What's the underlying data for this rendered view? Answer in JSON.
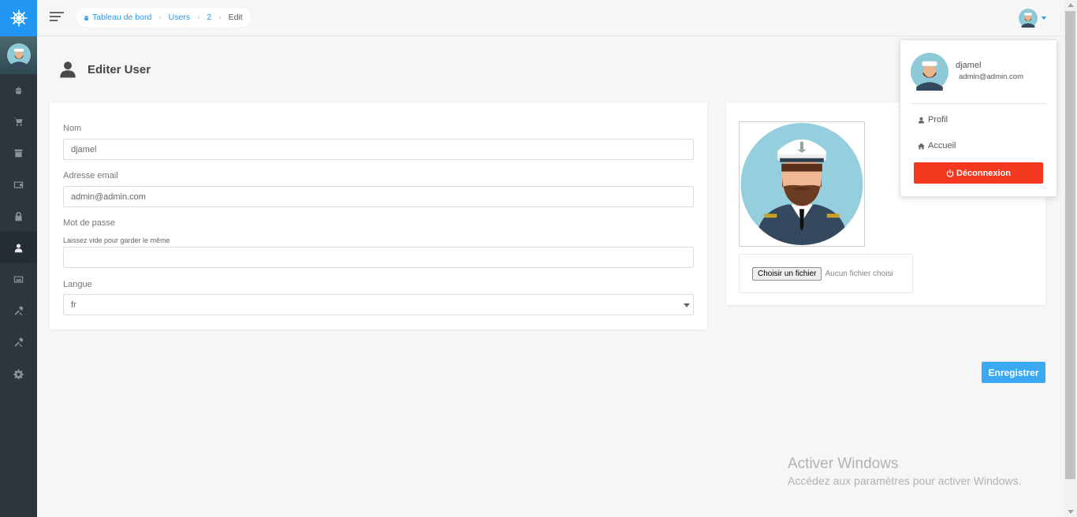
{
  "breadcrumb": {
    "items": [
      {
        "label": "Tableau de bord"
      },
      {
        "label": "Users"
      },
      {
        "label": "2"
      },
      {
        "label": "Edit"
      }
    ]
  },
  "page": {
    "title": "Editer User"
  },
  "form": {
    "name_label": "Nom",
    "name_value": "djamel",
    "email_label": "Adresse email",
    "email_value": "admin@admin.com",
    "password_label": "Mot de passe",
    "password_hint": "Laissez vide pour garder le même",
    "password_value": "",
    "language_label": "Langue",
    "language_value": "fr"
  },
  "avatar_upload": {
    "button_label": "Choisir un fichier",
    "status": "Aucun fichier choisi"
  },
  "save_button": "Enregistrer",
  "user_menu": {
    "name": "djamel",
    "email": "admin@admin.com",
    "profile_label": "Profil",
    "home_label": "Accueil",
    "logout_label": "Déconnexion"
  },
  "watermark": {
    "title": "Activer Windows",
    "subtitle": "Accédez aux paramètres pour activer Windows."
  },
  "colors": {
    "sidebar": "#2e353d",
    "brand": "#2196f3",
    "save": "#3aa9f2",
    "logout": "#f4371f"
  },
  "sidebar_icons": [
    "boat-icon",
    "cart-icon",
    "box-icon",
    "wallet-icon",
    "lock-icon",
    "user-icon",
    "image-icon",
    "tools-icon",
    "tools-icon",
    "gear-icon"
  ]
}
